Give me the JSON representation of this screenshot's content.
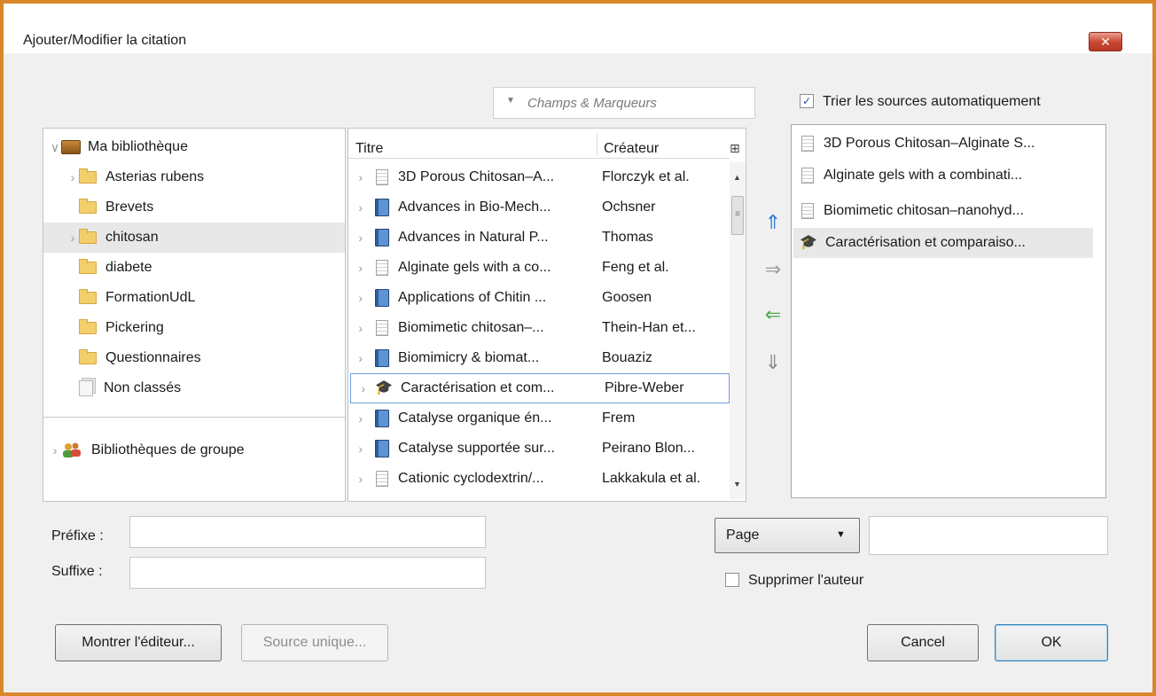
{
  "window": {
    "title": "Ajouter/Modifier la citation",
    "close_glyph": "✕"
  },
  "search": {
    "placeholder": "Champs & Marqueurs",
    "dropdown_glyph": "▼"
  },
  "sort_auto": {
    "label": "Trier les sources automatiquement",
    "checked": true,
    "check_glyph": "✓"
  },
  "tree": {
    "twisty_open": "∨",
    "twisty_closed": "›",
    "root": "Ma bibliothèque",
    "items": [
      {
        "label": "Asterias rubens",
        "expandable": true
      },
      {
        "label": "Brevets",
        "expandable": false
      },
      {
        "label": "chitosan",
        "expandable": true
      },
      {
        "label": "diabete",
        "expandable": false
      },
      {
        "label": "FormationUdL",
        "expandable": false
      },
      {
        "label": "Pickering",
        "expandable": false
      },
      {
        "label": "Questionnaires",
        "expandable": false
      },
      {
        "label": "Non classés",
        "expandable": false
      }
    ],
    "group": "Bibliothèques de groupe"
  },
  "items": {
    "col_title": "Titre",
    "col_creator": "Créateur",
    "col_picker_glyph": "⊞",
    "twisty": "›",
    "rows": [
      {
        "title": "3D Porous Chitosan–A...",
        "creator": "Florczyk et al.",
        "type": "doc"
      },
      {
        "title": "Advances in Bio-Mech...",
        "creator": "Ochsner",
        "type": "book"
      },
      {
        "title": "Advances in Natural P...",
        "creator": "Thomas",
        "type": "book"
      },
      {
        "title": "Alginate gels with a co...",
        "creator": "Feng et al.",
        "type": "doc"
      },
      {
        "title": "Applications of Chitin ...",
        "creator": "Goosen",
        "type": "book"
      },
      {
        "title": "Biomimetic chitosan–...",
        "creator": "Thein-Han et...",
        "type": "doc"
      },
      {
        "title": "Biomimicry & biomat...",
        "creator": "Bouaziz",
        "type": "book"
      },
      {
        "title": "Caractérisation et com...",
        "creator": "Pibre-Weber",
        "type": "thesis"
      },
      {
        "title": "Catalyse organique én...",
        "creator": "Frem",
        "type": "book"
      },
      {
        "title": "Catalyse supportée sur...",
        "creator": "Peirano Blon...",
        "type": "book"
      },
      {
        "title": "Cationic cyclodextrin/...",
        "creator": "Lakkakula et al.",
        "type": "doc"
      }
    ],
    "scroll_up": "▲",
    "scroll_down": "▼",
    "scroll_grip": "≡"
  },
  "move": {
    "up": "⇑",
    "add": "⇒",
    "remove": "⇐",
    "down": "⇓"
  },
  "selected": [
    {
      "title": "3D Porous Chitosan–Alginate S...",
      "type": "doc"
    },
    {
      "title": "Alginate gels with a combinati...",
      "type": "doc"
    },
    {
      "title": "Biomimetic chitosan–nanohyd...",
      "type": "doc"
    },
    {
      "title": "Caractérisation et comparaiso...",
      "type": "thesis"
    }
  ],
  "prefix": {
    "label": "Préfixe :",
    "value": ""
  },
  "suffix": {
    "label": "Suffixe :",
    "value": ""
  },
  "locator": {
    "selected": "Page",
    "dropdown_glyph": "▼",
    "value": ""
  },
  "suppress_author": {
    "label": "Supprimer l'auteur",
    "checked": false
  },
  "buttons": {
    "show_editor": "Montrer l'éditeur...",
    "single_source": "Source unique...",
    "cancel": "Cancel",
    "ok": "OK"
  },
  "thesis_glyph": "🎓",
  "colors": {
    "frame": "#d9872a",
    "selection": "#e8e8e8",
    "focus_border": "#6e9fd6",
    "up_arrow": "#2e7cd6",
    "remove_arrow": "#4aa84a"
  }
}
